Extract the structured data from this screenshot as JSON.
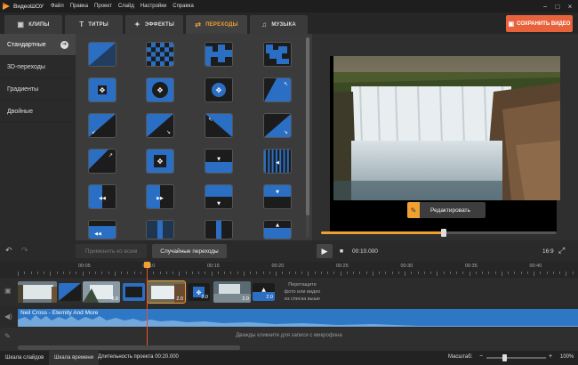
{
  "app": {
    "name": "ВидеоШОУ"
  },
  "menu": [
    "Файл",
    "Правка",
    "Проект",
    "Слайд",
    "Настройки",
    "Справка"
  ],
  "window_controls": [
    "−",
    "□",
    "×"
  ],
  "tabs": [
    {
      "label": "КЛИПЫ",
      "icon": "film-icon",
      "glyph": "▣",
      "active": false
    },
    {
      "label": "ТИТРЫ",
      "icon": "titles-icon",
      "glyph": "T",
      "active": false
    },
    {
      "label": "ЭФФЕКТЫ",
      "icon": "effects-icon",
      "glyph": "✦",
      "active": false
    },
    {
      "label": "ПЕРЕХОДЫ",
      "icon": "transitions-icon",
      "glyph": "⇄",
      "active": true
    },
    {
      "label": "МУЗЫКА",
      "icon": "music-icon",
      "glyph": "♫",
      "active": false
    }
  ],
  "save_button": {
    "label": "СОХРАНИТЬ ВИДЕО",
    "icon": "film-save-icon"
  },
  "categories": [
    {
      "label": "Стандартные",
      "active": true
    },
    {
      "label": "3D-переходы",
      "active": false
    },
    {
      "label": "Градиенты",
      "active": false
    },
    {
      "label": "Двойные",
      "active": false
    }
  ],
  "category_arrow": "➔",
  "edit_button": {
    "label": "Редактировать",
    "icon": "pencil-icon",
    "glyph": "✎"
  },
  "progress": {
    "fraction": 0.52
  },
  "toolbar": {
    "undo": "↶",
    "redo": "↷",
    "apply_all": "Применить ко всем",
    "random_transitions": "Случайные переходы",
    "play": "▶",
    "stop": "■",
    "timecode": "00:10.000",
    "aspect": "16:9",
    "fullscreen": "⤢"
  },
  "ruler": [
    "00:05",
    "00:10",
    "00:15",
    "00:20",
    "00:25",
    "00:30",
    "00:35",
    "00:40"
  ],
  "timeline": {
    "durations": [
      "2.0",
      "2.0",
      "2.0",
      "2.0",
      "2.0"
    ],
    "dropzone": [
      "Перетащите",
      "фото или видео",
      "из списка выше"
    ],
    "audio_label": "Neil Cross - Eternity And More",
    "mic_hint": "Дважды кликните для записи с микрофона"
  },
  "status": {
    "tab_slides": "Шкала слайдов",
    "tab_timeline": "Шкала времени",
    "duration": "Длительность проекта 00:20.000",
    "zoom_label": "Масштаб:",
    "zoom_value": "100%",
    "zoom_fraction": 0.3,
    "zoom_minus": "−",
    "zoom_plus": "+"
  },
  "colors": {
    "accent": "#f0a030",
    "save": "#e8633c",
    "transition_blue": "#2b6fc4",
    "audio": "#2e77c4"
  }
}
